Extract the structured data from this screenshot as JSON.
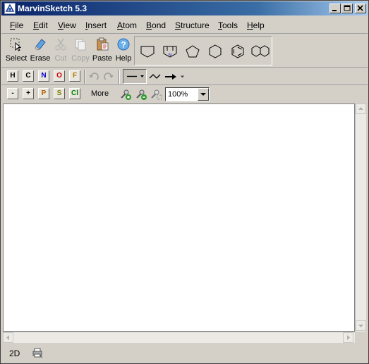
{
  "window": {
    "title": "MarvinSketch 5.3"
  },
  "menu": [
    {
      "name": "File",
      "u": "F",
      "rest": "ile"
    },
    {
      "name": "Edit",
      "u": "E",
      "rest": "dit"
    },
    {
      "name": "View",
      "u": "V",
      "rest": "iew"
    },
    {
      "name": "Insert",
      "u": "I",
      "rest": "nsert"
    },
    {
      "name": "Atom",
      "u": "A",
      "rest": "tom"
    },
    {
      "name": "Bond",
      "u": "B",
      "rest": "ond"
    },
    {
      "name": "Structure",
      "u": "S",
      "rest": "tructure"
    },
    {
      "name": "Tools",
      "u": "T",
      "rest": "ools"
    },
    {
      "name": "Help",
      "u": "H",
      "rest": "elp"
    }
  ],
  "toolbar": {
    "select": "Select",
    "erase": "Erase",
    "cut": "Cut",
    "copy": "Copy",
    "paste": "Paste",
    "help": "Help"
  },
  "atoms": {
    "h": "H",
    "c": "C",
    "n": "N",
    "o": "O",
    "f": "F"
  },
  "atom_colors": {
    "h": "#000000",
    "c": "#000000",
    "n": "#0000cc",
    "o": "#cc0000",
    "f": "#b07a00"
  },
  "row3": {
    "minus": "-",
    "plus": "+",
    "p": "P",
    "s": "S",
    "cl": "Cl",
    "more": "More"
  },
  "row3_colors": {
    "p": "#b06000",
    "s": "#808000",
    "cl": "#008000"
  },
  "zoom": {
    "value": "100%"
  },
  "status": {
    "mode": "2D"
  },
  "shapes": [
    "cyclobutane-like",
    "pyrrole-N",
    "pentagon",
    "hexagon",
    "benzene",
    "naphthalene"
  ]
}
